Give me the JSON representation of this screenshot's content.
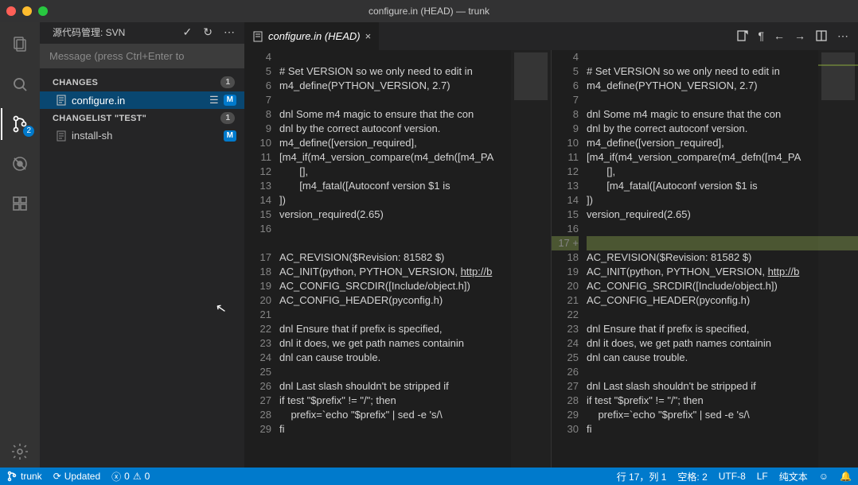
{
  "window": {
    "title": "configure.in (HEAD) — trunk"
  },
  "sidebar": {
    "scm_title": "源代码管理: SVN",
    "message_placeholder": "Message (press Ctrl+Enter to",
    "sections": {
      "changes": {
        "label": "CHANGES",
        "count": "1"
      },
      "changelist": {
        "label": "CHANGELIST \"TEST\"",
        "count": "1"
      }
    },
    "files": {
      "configure": {
        "name": "configure.in",
        "status": "M"
      },
      "install_sh": {
        "name": "install-sh",
        "status": "M"
      }
    }
  },
  "activity": {
    "scm_badge": "2"
  },
  "tab": {
    "label": "configure.in (HEAD)"
  },
  "code_left": [
    {
      "n": "4",
      "t": ""
    },
    {
      "n": "5",
      "t": "# Set VERSION so we only need to edit in"
    },
    {
      "n": "6",
      "t": "m4_define(PYTHON_VERSION, 2.7)"
    },
    {
      "n": "7",
      "t": ""
    },
    {
      "n": "8",
      "t": "dnl Some m4 magic to ensure that the con"
    },
    {
      "n": "9",
      "t": "dnl by the correct autoconf version."
    },
    {
      "n": "10",
      "t": "m4_define([version_required],"
    },
    {
      "n": "11",
      "t": "[m4_if(m4_version_compare(m4_defn([m4_PA"
    },
    {
      "n": "12",
      "t": "       [],",
      "indent": 1
    },
    {
      "n": "13",
      "t": "       [m4_fatal([Autoconf version $1 is",
      "indent": 1
    },
    {
      "n": "14",
      "t": "])"
    },
    {
      "n": "15",
      "t": "version_required(2.65)"
    },
    {
      "n": "16",
      "t": ""
    },
    {
      "n": "",
      "t": ""
    },
    {
      "n": "17",
      "t": "AC_REVISION($Revision: 81582 $)"
    },
    {
      "n": "18",
      "t": "AC_INIT(python, PYTHON_VERSION, http://b",
      "link": true
    },
    {
      "n": "19",
      "t": "AC_CONFIG_SRCDIR([Include/object.h])"
    },
    {
      "n": "20",
      "t": "AC_CONFIG_HEADER(pyconfig.h)"
    },
    {
      "n": "21",
      "t": ""
    },
    {
      "n": "22",
      "t": "dnl Ensure that if prefix is specified, "
    },
    {
      "n": "23",
      "t": "dnl it does, we get path names containin"
    },
    {
      "n": "24",
      "t": "dnl can cause trouble."
    },
    {
      "n": "25",
      "t": ""
    },
    {
      "n": "26",
      "t": "dnl Last slash shouldn't be stripped if "
    },
    {
      "n": "27",
      "t": "if test \"$prefix\" != \"/\"; then"
    },
    {
      "n": "28",
      "t": "    prefix=`echo \"$prefix\" | sed -e 's/\\"
    },
    {
      "n": "29",
      "t": "fi"
    }
  ],
  "code_right": [
    {
      "n": "4",
      "t": ""
    },
    {
      "n": "5",
      "t": "# Set VERSION so we only need to edit in"
    },
    {
      "n": "6",
      "t": "m4_define(PYTHON_VERSION, 2.7)"
    },
    {
      "n": "7",
      "t": ""
    },
    {
      "n": "8",
      "t": "dnl Some m4 magic to ensure that the con"
    },
    {
      "n": "9",
      "t": "dnl by the correct autoconf version."
    },
    {
      "n": "10",
      "t": "m4_define([version_required],"
    },
    {
      "n": "11",
      "t": "[m4_if(m4_version_compare(m4_defn([m4_PA"
    },
    {
      "n": "12",
      "t": "       [],",
      "indent": 1
    },
    {
      "n": "13",
      "t": "       [m4_fatal([Autoconf version $1 is",
      "indent": 1
    },
    {
      "n": "14",
      "t": "])"
    },
    {
      "n": "15",
      "t": "version_required(2.65)"
    },
    {
      "n": "16",
      "t": ""
    },
    {
      "n": "17",
      "t": "",
      "added": true,
      "plus": true
    },
    {
      "n": "18",
      "t": "AC_REVISION($Revision: 81582 $)"
    },
    {
      "n": "19",
      "t": "AC_INIT(python, PYTHON_VERSION, http://b",
      "link": true
    },
    {
      "n": "20",
      "t": "AC_CONFIG_SRCDIR([Include/object.h])"
    },
    {
      "n": "21",
      "t": "AC_CONFIG_HEADER(pyconfig.h)"
    },
    {
      "n": "22",
      "t": ""
    },
    {
      "n": "23",
      "t": "dnl Ensure that if prefix is specified, "
    },
    {
      "n": "24",
      "t": "dnl it does, we get path names containin"
    },
    {
      "n": "25",
      "t": "dnl can cause trouble."
    },
    {
      "n": "26",
      "t": ""
    },
    {
      "n": "27",
      "t": "dnl Last slash shouldn't be stripped if "
    },
    {
      "n": "28",
      "t": "if test \"$prefix\" != \"/\"; then"
    },
    {
      "n": "29",
      "t": "    prefix=`echo \"$prefix\" | sed -e 's/\\"
    },
    {
      "n": "30",
      "t": "fi"
    }
  ],
  "status": {
    "branch": "trunk",
    "sync": "Updated",
    "errors": "0",
    "warnings": "0",
    "cursor": "行 17，列 1",
    "spaces": "空格: 2",
    "encoding": "UTF-8",
    "eol": "LF",
    "lang": "纯文本"
  }
}
